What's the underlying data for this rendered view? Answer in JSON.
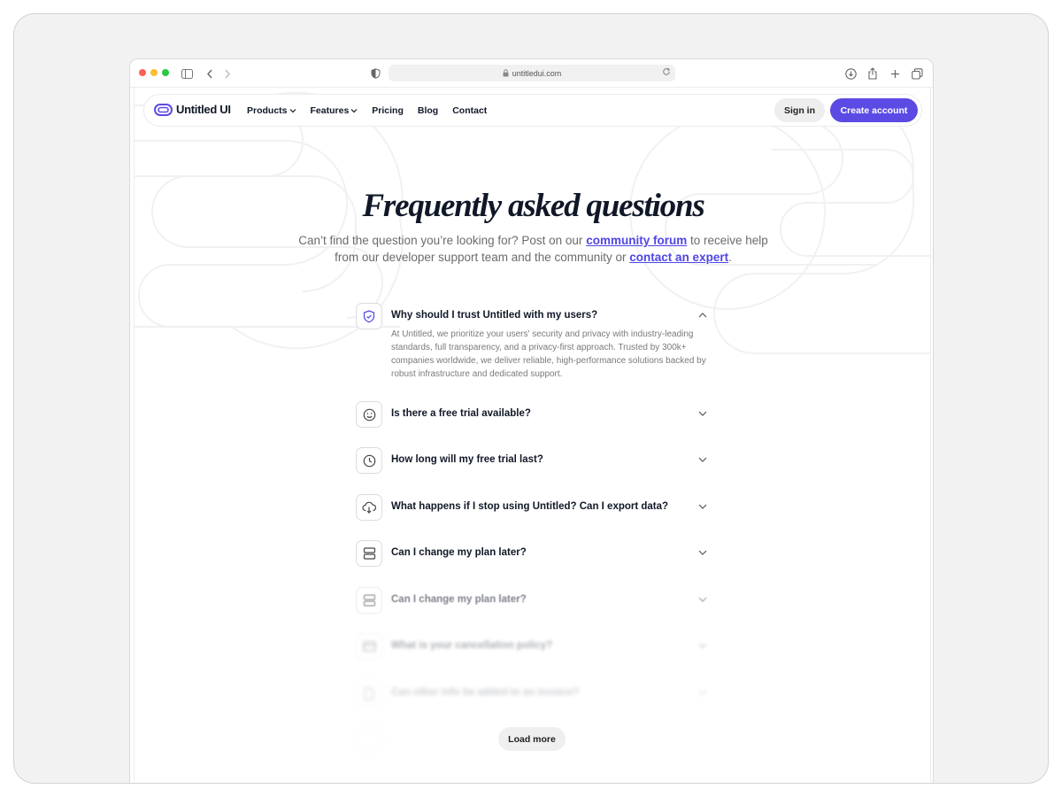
{
  "browser": {
    "url": "untitledui.com",
    "traffic_lights": [
      "#ff5f57",
      "#febc2e",
      "#28c840"
    ]
  },
  "nav": {
    "logo_text": "Untitled UI",
    "menu": [
      {
        "label": "Products",
        "has_dropdown": true
      },
      {
        "label": "Features",
        "has_dropdown": true
      },
      {
        "label": "Pricing",
        "has_dropdown": false
      },
      {
        "label": "Blog",
        "has_dropdown": false
      },
      {
        "label": "Contact",
        "has_dropdown": false
      }
    ],
    "signin_label": "Sign in",
    "create_label": "Create account",
    "accent_color": "#5c4ae4"
  },
  "hero": {
    "title": "Frequently asked questions",
    "sub_part1": "Can’t find the question you’re looking for? Post on our ",
    "link1": "community forum",
    "sub_part2": " to receive help from our developer support team and the community or ",
    "link2": "contact an expert",
    "sub_part3": "."
  },
  "faq": {
    "items": [
      {
        "question": "Why should I trust Untitled with my users?",
        "icon": "shield-check-icon",
        "expanded": true,
        "answer": "At Untitled, we prioritize your users' security and privacy with industry-leading standards, full transparency, and a privacy-first approach. Trusted by 300k+ companies worldwide, we deliver reliable, high-performance solutions backed by robust infrastructure and dedicated support."
      },
      {
        "question": "Is there a free trial available?",
        "icon": "smile-icon",
        "expanded": false
      },
      {
        "question": "How long will my free trial last?",
        "icon": "clock-icon",
        "expanded": false
      },
      {
        "question": "What happens if I stop using Untitled? Can I export data?",
        "icon": "cloud-download-icon",
        "expanded": false
      },
      {
        "question": "Can I change my plan later?",
        "icon": "server-icon",
        "expanded": false
      },
      {
        "question": "Can I change my plan later?",
        "icon": "server-icon",
        "expanded": false
      },
      {
        "question": "What is your cancellation policy?",
        "icon": "credit-card-icon",
        "expanded": false
      },
      {
        "question": "Can other info be added to an invoice?",
        "icon": "file-icon",
        "expanded": false
      }
    ],
    "load_more_label": "Load more"
  }
}
